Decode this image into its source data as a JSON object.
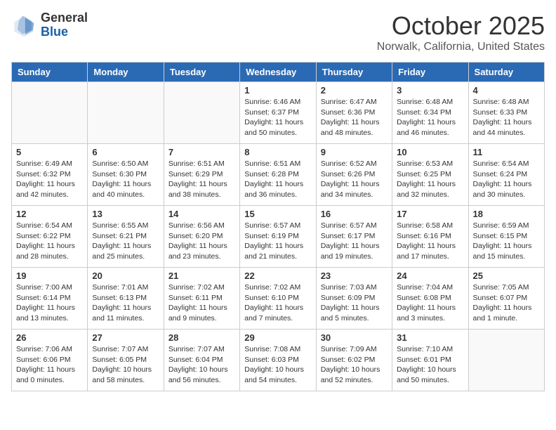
{
  "logo": {
    "general": "General",
    "blue": "Blue"
  },
  "header": {
    "month": "October 2025",
    "location": "Norwalk, California, United States"
  },
  "days_of_week": [
    "Sunday",
    "Monday",
    "Tuesday",
    "Wednesday",
    "Thursday",
    "Friday",
    "Saturday"
  ],
  "weeks": [
    [
      {
        "day": "",
        "info": ""
      },
      {
        "day": "",
        "info": ""
      },
      {
        "day": "",
        "info": ""
      },
      {
        "day": "1",
        "info": "Sunrise: 6:46 AM\nSunset: 6:37 PM\nDaylight: 11 hours\nand 50 minutes."
      },
      {
        "day": "2",
        "info": "Sunrise: 6:47 AM\nSunset: 6:36 PM\nDaylight: 11 hours\nand 48 minutes."
      },
      {
        "day": "3",
        "info": "Sunrise: 6:48 AM\nSunset: 6:34 PM\nDaylight: 11 hours\nand 46 minutes."
      },
      {
        "day": "4",
        "info": "Sunrise: 6:48 AM\nSunset: 6:33 PM\nDaylight: 11 hours\nand 44 minutes."
      }
    ],
    [
      {
        "day": "5",
        "info": "Sunrise: 6:49 AM\nSunset: 6:32 PM\nDaylight: 11 hours\nand 42 minutes."
      },
      {
        "day": "6",
        "info": "Sunrise: 6:50 AM\nSunset: 6:30 PM\nDaylight: 11 hours\nand 40 minutes."
      },
      {
        "day": "7",
        "info": "Sunrise: 6:51 AM\nSunset: 6:29 PM\nDaylight: 11 hours\nand 38 minutes."
      },
      {
        "day": "8",
        "info": "Sunrise: 6:51 AM\nSunset: 6:28 PM\nDaylight: 11 hours\nand 36 minutes."
      },
      {
        "day": "9",
        "info": "Sunrise: 6:52 AM\nSunset: 6:26 PM\nDaylight: 11 hours\nand 34 minutes."
      },
      {
        "day": "10",
        "info": "Sunrise: 6:53 AM\nSunset: 6:25 PM\nDaylight: 11 hours\nand 32 minutes."
      },
      {
        "day": "11",
        "info": "Sunrise: 6:54 AM\nSunset: 6:24 PM\nDaylight: 11 hours\nand 30 minutes."
      }
    ],
    [
      {
        "day": "12",
        "info": "Sunrise: 6:54 AM\nSunset: 6:22 PM\nDaylight: 11 hours\nand 28 minutes."
      },
      {
        "day": "13",
        "info": "Sunrise: 6:55 AM\nSunset: 6:21 PM\nDaylight: 11 hours\nand 25 minutes."
      },
      {
        "day": "14",
        "info": "Sunrise: 6:56 AM\nSunset: 6:20 PM\nDaylight: 11 hours\nand 23 minutes."
      },
      {
        "day": "15",
        "info": "Sunrise: 6:57 AM\nSunset: 6:19 PM\nDaylight: 11 hours\nand 21 minutes."
      },
      {
        "day": "16",
        "info": "Sunrise: 6:57 AM\nSunset: 6:17 PM\nDaylight: 11 hours\nand 19 minutes."
      },
      {
        "day": "17",
        "info": "Sunrise: 6:58 AM\nSunset: 6:16 PM\nDaylight: 11 hours\nand 17 minutes."
      },
      {
        "day": "18",
        "info": "Sunrise: 6:59 AM\nSunset: 6:15 PM\nDaylight: 11 hours\nand 15 minutes."
      }
    ],
    [
      {
        "day": "19",
        "info": "Sunrise: 7:00 AM\nSunset: 6:14 PM\nDaylight: 11 hours\nand 13 minutes."
      },
      {
        "day": "20",
        "info": "Sunrise: 7:01 AM\nSunset: 6:13 PM\nDaylight: 11 hours\nand 11 minutes."
      },
      {
        "day": "21",
        "info": "Sunrise: 7:02 AM\nSunset: 6:11 PM\nDaylight: 11 hours\nand 9 minutes."
      },
      {
        "day": "22",
        "info": "Sunrise: 7:02 AM\nSunset: 6:10 PM\nDaylight: 11 hours\nand 7 minutes."
      },
      {
        "day": "23",
        "info": "Sunrise: 7:03 AM\nSunset: 6:09 PM\nDaylight: 11 hours\nand 5 minutes."
      },
      {
        "day": "24",
        "info": "Sunrise: 7:04 AM\nSunset: 6:08 PM\nDaylight: 11 hours\nand 3 minutes."
      },
      {
        "day": "25",
        "info": "Sunrise: 7:05 AM\nSunset: 6:07 PM\nDaylight: 11 hours\nand 1 minute."
      }
    ],
    [
      {
        "day": "26",
        "info": "Sunrise: 7:06 AM\nSunset: 6:06 PM\nDaylight: 11 hours\nand 0 minutes."
      },
      {
        "day": "27",
        "info": "Sunrise: 7:07 AM\nSunset: 6:05 PM\nDaylight: 10 hours\nand 58 minutes."
      },
      {
        "day": "28",
        "info": "Sunrise: 7:07 AM\nSunset: 6:04 PM\nDaylight: 10 hours\nand 56 minutes."
      },
      {
        "day": "29",
        "info": "Sunrise: 7:08 AM\nSunset: 6:03 PM\nDaylight: 10 hours\nand 54 minutes."
      },
      {
        "day": "30",
        "info": "Sunrise: 7:09 AM\nSunset: 6:02 PM\nDaylight: 10 hours\nand 52 minutes."
      },
      {
        "day": "31",
        "info": "Sunrise: 7:10 AM\nSunset: 6:01 PM\nDaylight: 10 hours\nand 50 minutes."
      },
      {
        "day": "",
        "info": ""
      }
    ]
  ]
}
